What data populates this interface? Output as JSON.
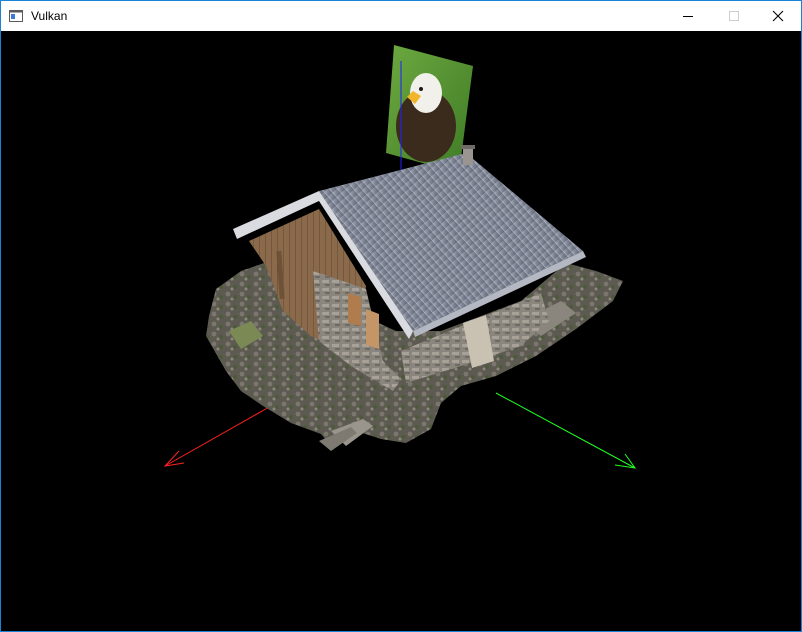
{
  "window": {
    "title": "Vulkan",
    "icon": "application-window-icon",
    "controls": [
      "minimize",
      "maximize",
      "close"
    ]
  },
  "scene": {
    "background_color": "#000000",
    "objects": [
      "house-model",
      "eagle-texture-quad",
      "x-axis-arrow",
      "y-axis-arrow",
      "z-axis-arrow"
    ],
    "axis_colors": {
      "x": "#ff2020",
      "y": "#20ff20",
      "z": "#2020ff"
    }
  }
}
